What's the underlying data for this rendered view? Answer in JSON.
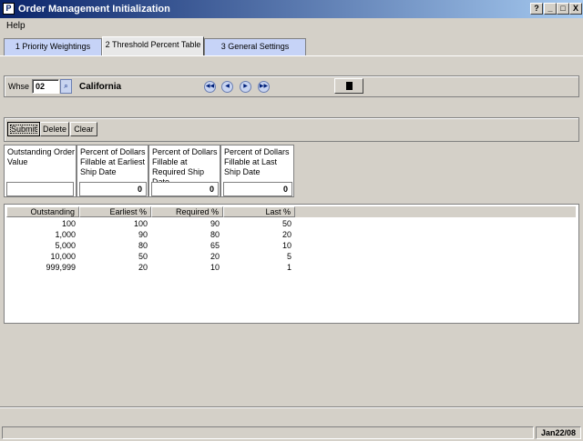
{
  "window": {
    "title": "Order Management Initialization",
    "app_icon": "P",
    "help_btn": "?",
    "min_btn": "_",
    "max_btn": "□",
    "close_btn": "X"
  },
  "menu": {
    "help": "Help"
  },
  "tabs": [
    {
      "label": "1 Priority Weightings"
    },
    {
      "label": "2 Threshold Percent Table"
    },
    {
      "label": "3 General Settings"
    }
  ],
  "warehouse": {
    "label": "Whse",
    "value": "02",
    "name": "California"
  },
  "nav": {
    "first": "◀◀",
    "prev": "◀",
    "next": "▶",
    "last": "▶▶"
  },
  "actions": {
    "submit": "Submit",
    "delete": "Delete",
    "clear": "Clear"
  },
  "fields": [
    {
      "label": "Outstanding Order Value",
      "value": ""
    },
    {
      "label": "Percent of Dollars Fillable at Earliest Ship Date",
      "value": "0"
    },
    {
      "label": "Percent of Dollars Fillable at Required Ship Date",
      "value": "0"
    },
    {
      "label": "Percent of Dollars Fillable at Last Ship Date",
      "value": "0"
    }
  ],
  "table": {
    "columns": [
      "Outstanding",
      "Earliest %",
      "Required %",
      "Last %"
    ],
    "rows": [
      [
        "100",
        "100",
        "90",
        "50"
      ],
      [
        "1,000",
        "90",
        "80",
        "20"
      ],
      [
        "5,000",
        "80",
        "65",
        "10"
      ],
      [
        "10,000",
        "50",
        "20",
        "5"
      ],
      [
        "999,999",
        "20",
        "10",
        "1"
      ]
    ]
  },
  "status": {
    "date": "Jan22/08"
  }
}
